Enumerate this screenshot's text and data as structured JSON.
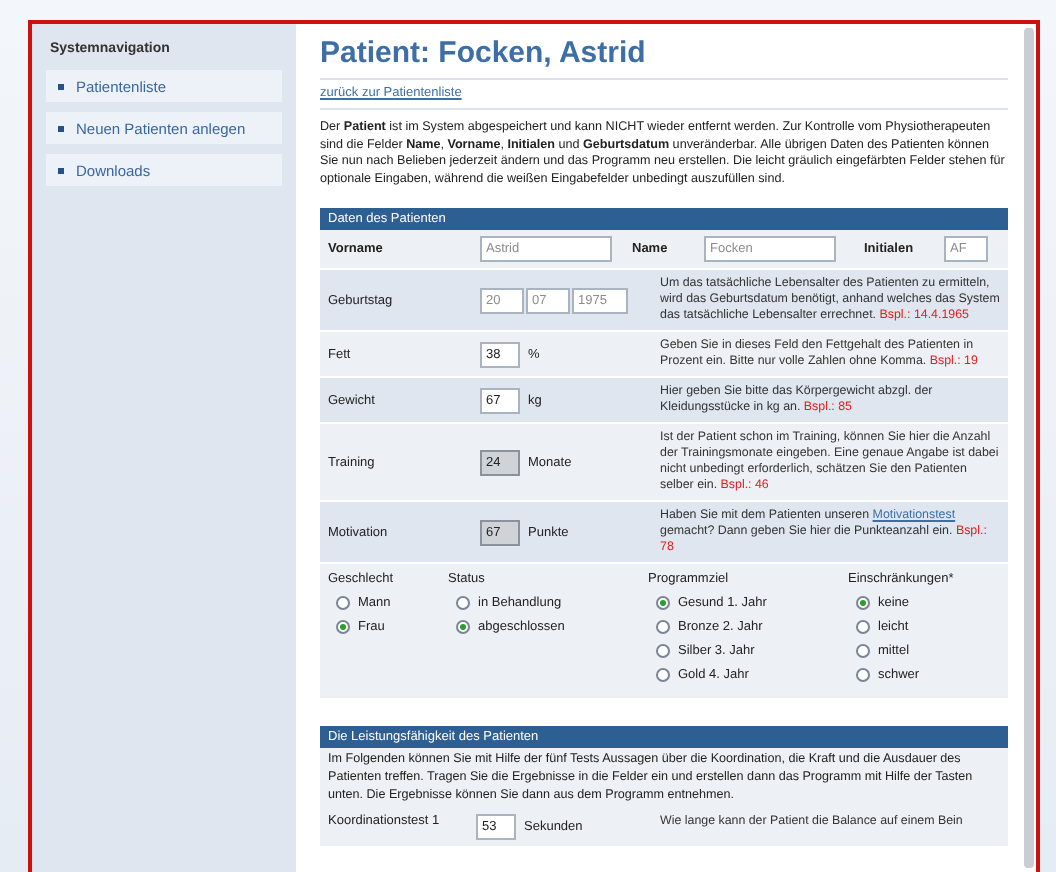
{
  "sidebar": {
    "title": "Systemnavigation",
    "items": [
      {
        "label": "Patientenliste"
      },
      {
        "label": "Neuen Patienten anlegen"
      },
      {
        "label": "Downloads"
      }
    ]
  },
  "page": {
    "title": "Patient: Focken, Astrid",
    "back_link": "zurück zur Patientenliste",
    "intro": "Der **Patient** ist im System abgespeichert und kann NICHT wieder entfernt werden. Zur Kontrolle vom Physiotherapeuten sind die Felder **Name**, **Vorname**, **Initialen** und **Geburtsdatum** unveränderbar. Alle übrigen Daten des Patienten können Sie nun nach Belieben jederzeit ändern und das Programm neu erstellen. Die leicht gräulich eingefärbten Felder stehen für optionale Eingaben, während die weißen Eingabefelder unbedingt auszufüllen sind."
  },
  "patient_data": {
    "title": "Daten des Patienten",
    "name_row": [
      {
        "label": "Vorname",
        "value": "Astrid",
        "disabled": true
      },
      {
        "label": "Name",
        "value": "Focken",
        "disabled": true
      },
      {
        "label": "Initialen",
        "value": "AF",
        "disabled": true
      }
    ],
    "birthday": {
      "label": "Geburtstag",
      "parts": [
        "20",
        "07",
        "1975"
      ],
      "disabled": true,
      "help": [
        {
          "kind": "text",
          "text": "Um das tatsächliche Lebensalter des Patienten zu ermitteln, wird das Geburtsdatum benötigt, anhand welches das System das tatsächliche Lebensalter errechnet."
        },
        {
          "kind": "example",
          "text": "Bspl.: 14.4.1965"
        }
      ]
    },
    "fields": [
      {
        "label": "Fett",
        "value": "38",
        "unit": "%",
        "optional": false,
        "help": [
          {
            "kind": "text",
            "text": "Geben Sie in dieses Feld den Fettgehalt des Patienten in Prozent ein. Bitte nur volle Zahlen ohne Komma."
          },
          {
            "kind": "example",
            "text": "Bspl.: 19"
          }
        ]
      },
      {
        "label": "Gewicht",
        "value": "67",
        "unit": "kg",
        "optional": false,
        "help": [
          {
            "kind": "text",
            "text": "Hier geben Sie bitte das Körpergewicht abzgl. der Kleidungsstücke in kg an."
          },
          {
            "kind": "example",
            "text": "Bspl.: 85"
          }
        ]
      },
      {
        "label": "Training",
        "value": "24",
        "unit": "Monate",
        "optional": true,
        "help": [
          {
            "kind": "text",
            "text": "Ist der Patient schon im Training, können Sie hier die Anzahl der Trainingsmonate eingeben. Eine genaue Angabe ist dabei nicht unbedingt erforderlich, schätzen Sie den Patienten selber ein."
          },
          {
            "kind": "example",
            "text": "Bspl.: 46"
          }
        ]
      },
      {
        "label": "Motivation",
        "value": "67",
        "unit": "Punkte",
        "optional": true,
        "help": [
          {
            "kind": "text",
            "text": "Haben Sie mit dem Patienten unseren"
          },
          {
            "kind": "link",
            "text": "Motivationstest"
          },
          {
            "kind": "text",
            "text": "gemacht? Dann geben Sie hier die Punkteanzahl ein."
          },
          {
            "kind": "example",
            "text": "Bspl.: 78"
          }
        ]
      }
    ],
    "radio_groups": [
      {
        "label": "Geschlecht",
        "options": [
          {
            "label": "Mann",
            "selected": false
          },
          {
            "label": "Frau",
            "selected": true
          }
        ]
      },
      {
        "label": "Status",
        "options": [
          {
            "label": "in Behandlung",
            "selected": false
          },
          {
            "label": "abgeschlossen",
            "selected": true
          }
        ]
      },
      {
        "label": "Programmziel",
        "options": [
          {
            "label": "Gesund 1. Jahr",
            "selected": true
          },
          {
            "label": "Bronze 2. Jahr",
            "selected": false
          },
          {
            "label": "Silber 3. Jahr",
            "selected": false
          },
          {
            "label": "Gold 4. Jahr",
            "selected": false
          }
        ]
      },
      {
        "label": "Einschränkungen*",
        "options": [
          {
            "label": "keine",
            "selected": true
          },
          {
            "label": "leicht",
            "selected": false
          },
          {
            "label": "mittel",
            "selected": false
          },
          {
            "label": "schwer",
            "selected": false
          }
        ]
      }
    ]
  },
  "performance": {
    "title": "Die Leistungsfähigkeit des Patienten",
    "intro": "Im Folgenden können Sie mit Hilfe der fünf Tests Aussagen über die Koordination, die Kraft und die Ausdauer des Patienten treffen. Tragen Sie die Ergebnisse in die Felder ein und erstellen dann das Programm mit Hilfe der Tasten unten. Die Ergebnisse können Sie dann aus dem Programm entnehmen.",
    "rows": [
      {
        "label": "Koordinationstest 1",
        "value": "53",
        "unit": "Sekunden",
        "help": "Wie lange kann der Patient die Balance auf einem Bein"
      }
    ]
  }
}
